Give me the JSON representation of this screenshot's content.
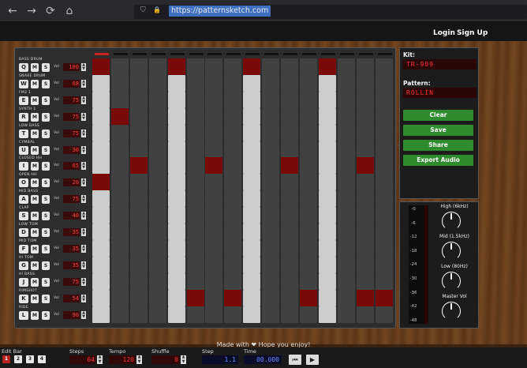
{
  "browser": {
    "url": "https://patternsketch.com",
    "back_icon": "←",
    "forward_icon": "→",
    "reload_icon": "⟳",
    "home_icon": "⌂",
    "shield_icon": "⛉",
    "lock_icon": "🔒"
  },
  "header": {
    "login": "Login",
    "signup": "Sign Up"
  },
  "step_indicator": {
    "count": 16,
    "active": 1
  },
  "tracks": [
    {
      "name": "BASS DRUM",
      "key": "Q",
      "vol": "100",
      "steps": [
        1,
        5,
        9,
        13
      ]
    },
    {
      "name": "SNARE DRUM",
      "key": "W",
      "vol": "68",
      "steps": []
    },
    {
      "name": "FM2 1",
      "key": "E",
      "vol": "75",
      "steps": []
    },
    {
      "name": "SYNTH 1",
      "key": "R",
      "vol": "75",
      "steps": [
        2
      ]
    },
    {
      "name": "LOW BASS",
      "key": "T",
      "vol": "75",
      "steps": []
    },
    {
      "name": "CYMBAL",
      "key": "U",
      "vol": "30",
      "steps": []
    },
    {
      "name": "CLOSED HH",
      "key": "I",
      "vol": "65",
      "steps": [
        3,
        7,
        11,
        15
      ]
    },
    {
      "name": "OPEN HH",
      "key": "O",
      "vol": "20",
      "steps": [
        1
      ]
    },
    {
      "name": "MID BASS",
      "key": "A",
      "vol": "75",
      "steps": []
    },
    {
      "name": "CLAP",
      "key": "S",
      "vol": "40",
      "steps": []
    },
    {
      "name": "LOW TOM",
      "key": "D",
      "vol": "35",
      "steps": []
    },
    {
      "name": "MID TOM",
      "key": "F",
      "vol": "35",
      "steps": []
    },
    {
      "name": "HI TOM",
      "key": "G",
      "vol": "35",
      "steps": []
    },
    {
      "name": "HI BASS",
      "key": "J",
      "vol": "75",
      "steps": []
    },
    {
      "name": "RIMSHOT",
      "key": "K",
      "vol": "54",
      "steps": [
        6,
        8,
        12,
        15,
        16
      ]
    },
    {
      "name": "RIDE",
      "key": "L",
      "vol": "90",
      "steps": []
    }
  ],
  "track_labels": {
    "mute": "M",
    "solo": "S",
    "vol": "Vol",
    "spin_up": "▲",
    "spin_down": "▼"
  },
  "kit": {
    "title": "Kit:",
    "value": "TR-909"
  },
  "pattern": {
    "title": "Pattern:",
    "value": "ROLLIN"
  },
  "actions": {
    "clear": "Clear",
    "save": "Save",
    "share": "Share",
    "export": "Export Audio"
  },
  "meter_labels": [
    "-0",
    "-6",
    "-12",
    "-18",
    "-24",
    "-30",
    "-36",
    "-42",
    "-48"
  ],
  "knobs": [
    "High (6kHz)",
    "Mid (1.5kHz)",
    "Low (80Hz)",
    "Master Vol"
  ],
  "footer": {
    "text": "Made with ❤  Hope you enjoy!"
  },
  "bottom": {
    "edit_bar_label": "Edit Bar",
    "bars": [
      "1",
      "2",
      "3",
      "4"
    ],
    "active_bar": 1,
    "steps_label": "Steps",
    "steps_value": "64",
    "tempo_label": "Tempo",
    "tempo_value": "120",
    "shuffle_label": "Shuffle",
    "shuffle_value": "0",
    "step_label": "Step",
    "step_value": "1.1",
    "time_label": "Time",
    "time_value": "00.000",
    "rewind_icon": "⏮",
    "play_icon": "▶"
  },
  "colors": {
    "active_cell": "#7a0a0a",
    "dark_cell": "#414141",
    "light_cell": "#cccccc",
    "accent_green": "#2e8b2e"
  }
}
